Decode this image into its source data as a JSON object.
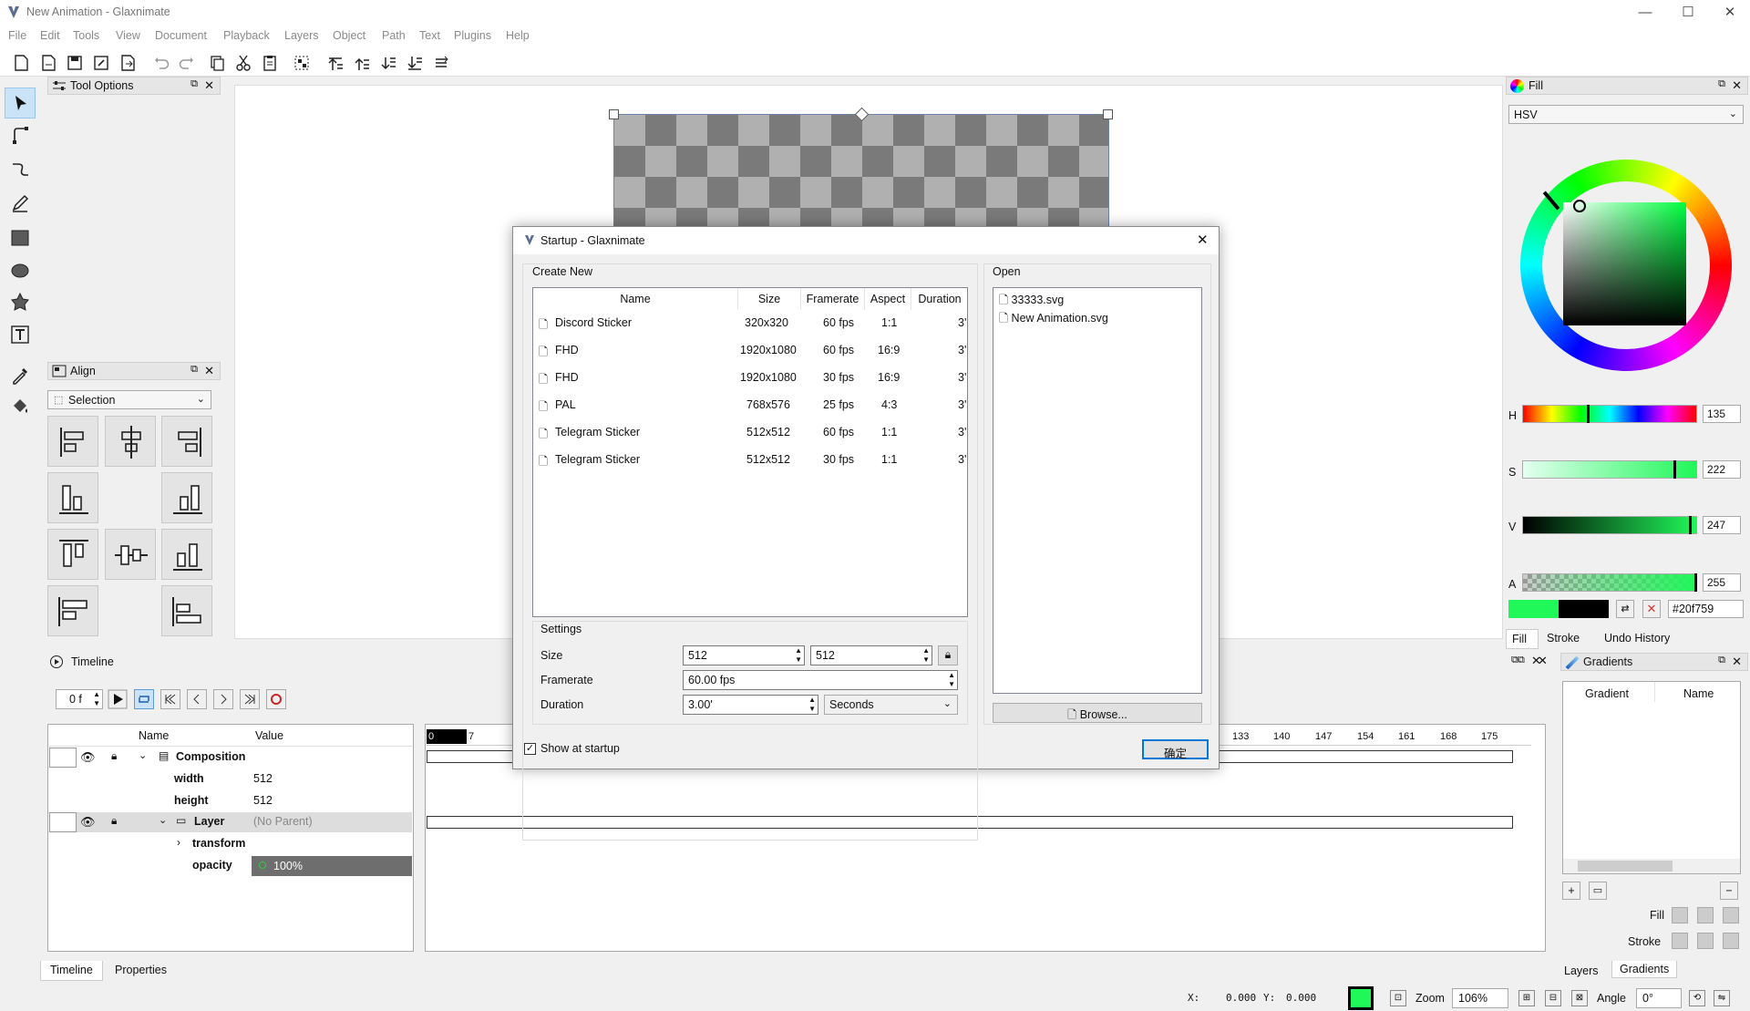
{
  "app": {
    "title": "New Animation - Glaxnimate"
  },
  "window_controls": {
    "minimize": "—",
    "maximize": "☐",
    "close": "✕"
  },
  "menu": [
    "File",
    "Edit",
    "Tools",
    "View",
    "Document",
    "Playback",
    "Layers",
    "Object",
    "Path",
    "Text",
    "Plugins",
    "Help"
  ],
  "toolbar": [
    "new-icon",
    "open-icon",
    "save-icon",
    "save-as-icon",
    "export-icon",
    "undo-icon",
    "redo-icon",
    "copy-icon",
    "cut-icon",
    "paste-icon",
    "group-icon",
    "raise-top-icon",
    "raise-icon",
    "lower-icon",
    "lower-bottom-icon",
    "cycle-icon"
  ],
  "tool_options": {
    "title": "Tool Options"
  },
  "align": {
    "title": "Align",
    "selection": "Selection"
  },
  "timeline": {
    "title": "Timeline",
    "frame": "0 f",
    "columns": {
      "name": "Name",
      "value": "Value"
    },
    "rows": [
      {
        "name": "Composition",
        "value": ""
      },
      {
        "name": "width",
        "value": "512"
      },
      {
        "name": "height",
        "value": "512"
      },
      {
        "name": "Layer",
        "value": "(No Parent)"
      },
      {
        "name": "transform",
        "value": ""
      },
      {
        "name": "opacity",
        "value": "100%"
      }
    ],
    "ruler": [
      "0",
      "7",
      "133",
      "140",
      "147",
      "154",
      "161",
      "168",
      "175"
    ],
    "tabs": [
      "Timeline",
      "Properties"
    ]
  },
  "fill_panel": {
    "title": "Fill",
    "mode": "HSV",
    "h": "135",
    "s": "222",
    "v": "247",
    "a": "255",
    "hex": "#20f759",
    "labels": {
      "h": "H",
      "s": "S",
      "v": "V",
      "a": "A"
    },
    "tabs": [
      "Fill",
      "Stroke",
      "Undo History"
    ],
    "colors": {
      "fill": "#20f759",
      "stroke": "#000000"
    }
  },
  "gradients": {
    "title": "Gradients",
    "columns": [
      "Gradient",
      "Name"
    ],
    "fill_label": "Fill",
    "stroke_label": "Stroke",
    "tabs": [
      "Layers",
      "Gradients"
    ]
  },
  "status": {
    "x_label": "X:",
    "x": "0.000",
    "y_label": "Y:",
    "y": "0.000",
    "zoom_label": "Zoom",
    "zoom": "106%",
    "angle_label": "Angle",
    "angle": "0°"
  },
  "dialog": {
    "title": "Startup - Glaxnimate",
    "create_new": "Create New",
    "open": "Open",
    "columns": [
      "Name",
      "Size",
      "Framerate",
      "Aspect",
      "Duration"
    ],
    "presets": [
      {
        "name": "Discord Sticker",
        "size": "320x320",
        "fps": "60 fps",
        "aspect": "1:1",
        "duration": "3'"
      },
      {
        "name": "FHD",
        "size": "1920x1080",
        "fps": "60 fps",
        "aspect": "16:9",
        "duration": "3'"
      },
      {
        "name": "FHD",
        "size": "1920x1080",
        "fps": "30 fps",
        "aspect": "16:9",
        "duration": "3'"
      },
      {
        "name": "PAL",
        "size": "768x576",
        "fps": "25 fps",
        "aspect": "4:3",
        "duration": "3'"
      },
      {
        "name": "Telegram Sticker",
        "size": "512x512",
        "fps": "60 fps",
        "aspect": "1:1",
        "duration": "3'"
      },
      {
        "name": "Telegram Sticker",
        "size": "512x512",
        "fps": "30 fps",
        "aspect": "1:1",
        "duration": "3'"
      }
    ],
    "recent": [
      "33333.svg",
      "New Animation.svg"
    ],
    "settings": {
      "title": "Settings",
      "size_label": "Size",
      "width": "512",
      "height": "512",
      "framerate_label": "Framerate",
      "framerate": "60.00 fps",
      "duration_label": "Duration",
      "duration": "3.00'",
      "unit": "Seconds"
    },
    "browse": "Browse...",
    "show_at_startup": "Show at startup",
    "ok": "确定"
  }
}
